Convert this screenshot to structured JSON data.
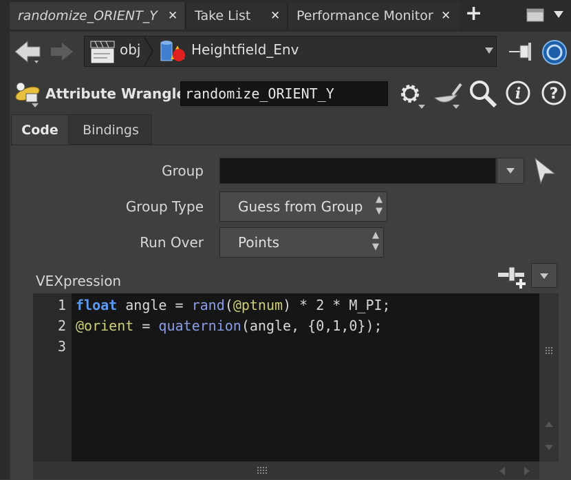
{
  "tabs": [
    {
      "label": "randomize_ORIENT_Y",
      "active": true
    },
    {
      "label": "Take List",
      "active": false
    },
    {
      "label": "Performance Monitor",
      "active": false
    }
  ],
  "tab_close_glyph": "✕",
  "add_tab_glyph": "+",
  "path": {
    "network": "obj",
    "node": "Heightfield_Env"
  },
  "node": {
    "type_label": "Attribute Wrangle",
    "name": "randomize_ORIENT_Y"
  },
  "subtabs": [
    {
      "label": "Code",
      "active": true
    },
    {
      "label": "Bindings",
      "active": false
    }
  ],
  "params": {
    "group_label": "Group",
    "group_value": "",
    "group_type_label": "Group Type",
    "group_type_value": "Guess from Group",
    "run_over_label": "Run Over",
    "run_over_value": "Points",
    "vex_label": "VEXpression"
  },
  "code": {
    "line_numbers": [
      "1",
      "2",
      "3"
    ],
    "line1": {
      "kw": "float",
      "a": " angle = ",
      "fn": "rand",
      "b": "(",
      "at": "@ptnum",
      "c": ") * 2 * M_PI;"
    },
    "line2": {
      "at": "@orient",
      "a": " = ",
      "fn": "quaternion",
      "b": "(angle, {0,1,0});"
    }
  },
  "colors": {
    "accent_blue": "#5d9bf0",
    "attr_yellow": "#cfcf7a"
  }
}
